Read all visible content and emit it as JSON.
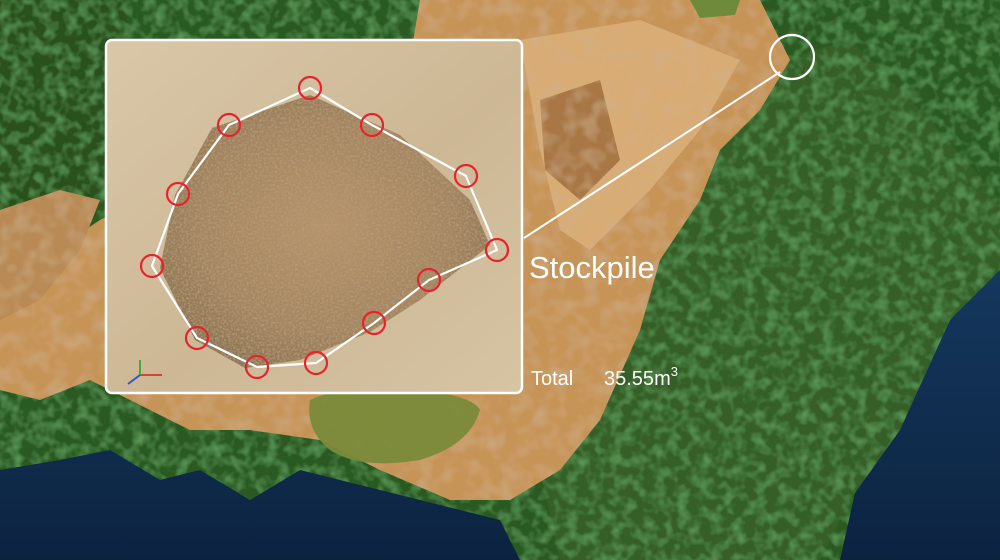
{
  "labels": {
    "object_name": "Stockpile",
    "total_label": "Total",
    "total_value": "35.55",
    "unit_base": "m",
    "unit_exponent": "3"
  },
  "colors": {
    "marker_stroke": "#e8222c",
    "outline_stroke": "#ffffff",
    "inset_border": "#ffffff",
    "water": "#163a63",
    "forest": "#2e5a22",
    "quarry_soil": "#c9955a",
    "pond": "#7d8a3c"
  },
  "icons": {
    "inset_axes": "axis-gizmo-icon",
    "leader_anchor": "location-circle-icon"
  }
}
